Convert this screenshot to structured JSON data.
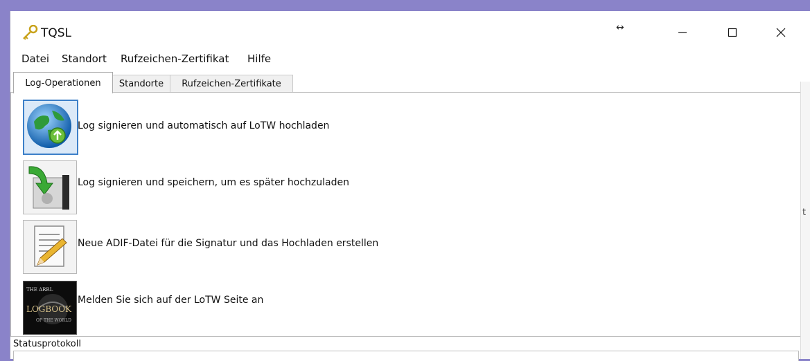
{
  "window": {
    "title": "TQSL"
  },
  "titlebar": {
    "resize_icon": "↔",
    "min_icon": "minimize-icon",
    "max_icon": "maximize-icon",
    "close_icon": "close-icon"
  },
  "menubar": {
    "items": [
      {
        "label": "Datei"
      },
      {
        "label": "Standort"
      },
      {
        "label": "Rufzeichen-Zertifikat"
      },
      {
        "label": "Hilfe"
      }
    ]
  },
  "tabs": [
    {
      "label": "Log-Operationen",
      "active": true
    },
    {
      "label": "Standorte",
      "active": false
    },
    {
      "label": "Rufzeichen-Zertifikate",
      "active": false
    }
  ],
  "operations": [
    {
      "label": "Log signieren und automatisch auf LoTW hochladen",
      "icon": "globe-upload-icon"
    },
    {
      "label": "Log signieren und speichern, um es später hochzuladen",
      "icon": "save-arrow-icon"
    },
    {
      "label": "Neue ADIF-Datei für die Signatur und das Hochladen erstellen",
      "icon": "document-pencil-icon"
    },
    {
      "label": "Melden Sie sich auf der LoTW Seite an",
      "icon": "logbook-icon",
      "icon_text": [
        "THE ARRL",
        "LOGBOOK",
        "OF THE WORLD"
      ]
    }
  ],
  "status": {
    "label": "Statusprotokoll"
  },
  "edge_text": "t"
}
